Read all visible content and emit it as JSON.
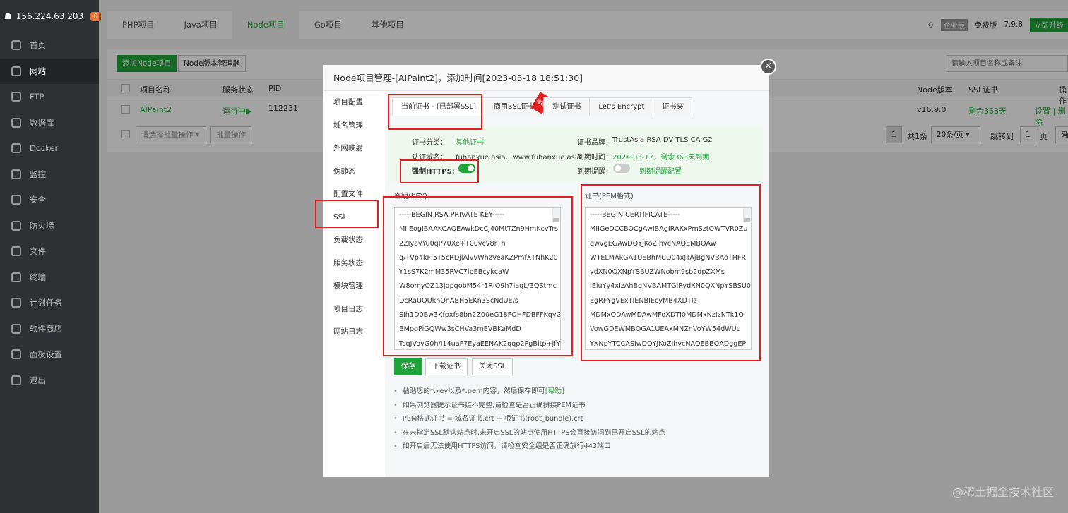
{
  "server": {
    "ip": "156.224.63.203",
    "badge": "0"
  },
  "sidebar": {
    "items": [
      {
        "label": "首页",
        "icon": "home-icon"
      },
      {
        "label": "网站",
        "icon": "globe-icon"
      },
      {
        "label": "FTP",
        "icon": "ftp-icon"
      },
      {
        "label": "数据库",
        "icon": "database-icon"
      },
      {
        "label": "Docker",
        "icon": "docker-icon"
      },
      {
        "label": "监控",
        "icon": "monitor-icon"
      },
      {
        "label": "安全",
        "icon": "shield-icon"
      },
      {
        "label": "防火墙",
        "icon": "firewall-icon"
      },
      {
        "label": "文件",
        "icon": "folder-icon"
      },
      {
        "label": "终端",
        "icon": "terminal-icon"
      },
      {
        "label": "计划任务",
        "icon": "calendar-icon"
      },
      {
        "label": "软件商店",
        "icon": "store-icon"
      },
      {
        "label": "面板设置",
        "icon": "gear-icon"
      },
      {
        "label": "退出",
        "icon": "logout-icon"
      }
    ]
  },
  "topbar": {
    "tabs": [
      "PHP项目",
      "Java项目",
      "Node项目",
      "Go项目",
      "其他项目"
    ],
    "enterprise": "企业版",
    "free": "免费版",
    "version": "7.9.8",
    "upgrade": "立即升级"
  },
  "toolbar": {
    "add_label": "添加Node项目",
    "manager_label": "Node版本管理器",
    "search_placeholder": "请输入项目名称或备注"
  },
  "table": {
    "headers": [
      "项目名称",
      "服务状态",
      "PID",
      "Node版本",
      "SSL证书",
      "操作"
    ],
    "row": {
      "name": "AIPaint2",
      "status": "运行中▶",
      "pid": "112231",
      "node_version": "v16.9.0",
      "ssl": "剩余363天",
      "actions": "设置 | 删除"
    }
  },
  "batch": {
    "select_placeholder": "请选择批量操作",
    "batch_label": "批量操作"
  },
  "pagination": {
    "page": "1",
    "total": "共1条",
    "per_page": "20条/页",
    "jump_label": "跳转到",
    "jump_value": "1",
    "page_unit": "页",
    "confirm": "确"
  },
  "modal": {
    "title": "Node项目管理-[AIPaint2]，添加时间[2023-03-18 18:51:30]",
    "close": "×",
    "menu": [
      "项目配置",
      "域名管理",
      "外网映射",
      "伪静态",
      "配置文件",
      "SSL",
      "负载状态",
      "服务状态",
      "模块管理",
      "项目日志",
      "网站日志"
    ],
    "ssl_tabs": [
      "当前证书 - [已部署SSL]",
      "商用SSL证书",
      "测试证书",
      "Let's Encrypt",
      "证书夹"
    ],
    "hot": "推荐",
    "info": {
      "cat_label": "证书分类：",
      "cat_value": "其他证书",
      "domain_label": "认证域名：",
      "domain_value": "fuhanxue.asia、www.fuhanxue.asia",
      "https_label": "强制HTTPS:",
      "brand_label": "证书品牌：",
      "brand_value": "TrustAsia RSA DV TLS CA G2",
      "expire_label": "到期时间：",
      "expire_value": "2024-03-17，剩余363天到期",
      "remind_label": "到期提醒：",
      "remind_link": "到期提醒配置"
    },
    "key_label": "密钥(KEY)",
    "cert_label": "证书(PEM格式)",
    "key_lines": [
      "-----BEGIN RSA PRIVATE KEY-----",
      "MIIEogIBAAKCAQEAwkDcCj40MtTZn9HmKcvTrs",
      "2ZIyavYu0qP70Xe+T00vcv8rTh",
      "q/TVp4kFI5T5cRDjlAlvvWhzVeaKZPmfXTNhK20",
      "Y1sS7K2mM35RVC7lpEBcykcaW",
      "W8omyOZ13jdpgobM54r1RIO9h7lagL/3QStmc",
      "DcRaUQUknQnABH5EKn3ScNdUE/s",
      "SIh1D0Bw3Kfpxfs8bn2Z00eG18FOHFDBFFKgyG",
      "BMpgPiGQWw3sCHVa3mEVBKaMdD",
      "TcqJVovG0h/I14uaF7EyaEENAK2qqp2PgBitp+jfY"
    ],
    "cert_lines": [
      "-----BEGIN CERTIFICATE-----",
      "MIIGeDCCBOCgAwIBAgIRAKxPmSztOWTVR0Zu",
      "qwvgEGAwDQYJKoZIhvcNAQEMBQAw",
      "WTELMAkGA1UEBhMCQ04xJTAjBgNVBAoTHFR",
      "ydXN0QXNpYSBUZWNobm9sb2dpZXMs",
      "IEluYy4xIzAhBgNVBAMTGlRydXN0QXNpYSBSU0",
      "EgRFYgVExTIENBIEcyMB4XDTIz",
      "MDMxODAwMDAwMFoXDTI0MDMxNzIzNTk1O",
      "VowGDEWMBQGA1UEAxMNZnVoYW54dWUu",
      "YXNpYTCCASIwDQYJKoZIhvcNAQEBBQADggEP"
    ],
    "buttons": {
      "save": "保存",
      "download": "下载证书",
      "close_ssl": "关闭SSL"
    },
    "tips_a": "粘贴您的*.key以及*.pem内容，然后保存即可",
    "tips_help": "[帮助]",
    "tips": [
      "如果浏览器提示证书链不完整,请检查是否正确拼接PEM证书",
      "PEM格式证书 = 域名证书.crt + 根证书(root_bundle).crt",
      "在未指定SSL默认站点时,未开启SSL的站点使用HTTPS会直接访问到已开启SSL的站点",
      "如开启后无法使用HTTPS访问，请检查安全组是否正确放行443端口"
    ]
  },
  "watermark": "@稀土掘金技术社区",
  "colors": {
    "accent": "#20a53a",
    "sidebar_bg": "#2e3033",
    "highlight": "#e02020"
  }
}
